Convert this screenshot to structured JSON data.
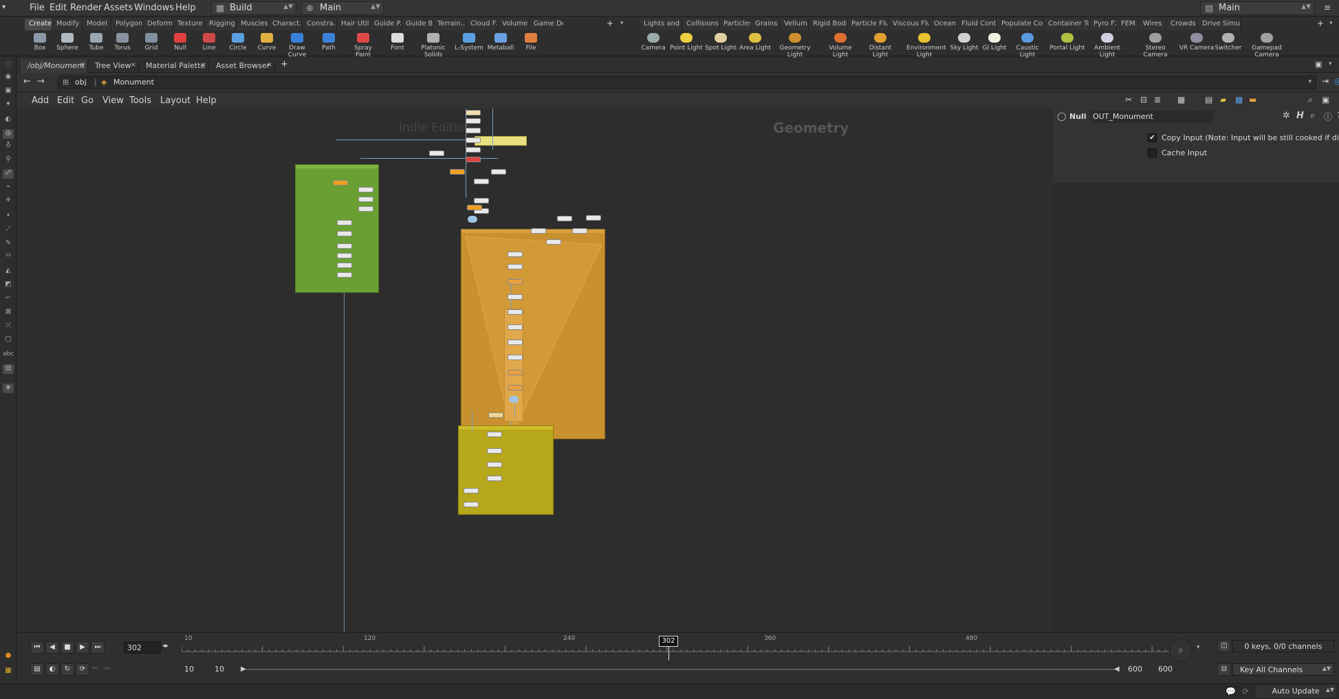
{
  "menubar": {
    "items": [
      "File",
      "Edit",
      "Render",
      "Assets",
      "Windows",
      "Help"
    ],
    "desktop": "Build",
    "context": "Main",
    "right_context": "Main"
  },
  "shelf_left": {
    "tabs": [
      "Create",
      "Modify",
      "Model",
      "Polygon",
      "Deform",
      "Texture",
      "Rigging",
      "Muscles",
      "Charact...",
      "Constra...",
      "Hair Utils",
      "Guide P...",
      "Guide B...",
      "Terrain...",
      "Cloud FX",
      "Volume",
      "Game De..."
    ],
    "tools": [
      {
        "label": "Box",
        "icon": "box-icon"
      },
      {
        "label": "Sphere",
        "icon": "sphere-icon"
      },
      {
        "label": "Tube",
        "icon": "tube-icon"
      },
      {
        "label": "Torus",
        "icon": "torus-icon"
      },
      {
        "label": "Grid",
        "icon": "grid-icon"
      },
      {
        "label": "Null",
        "icon": "null-icon"
      },
      {
        "label": "Line",
        "icon": "line-icon"
      },
      {
        "label": "Circle",
        "icon": "circle-icon"
      },
      {
        "label": "Curve",
        "icon": "curve-icon"
      },
      {
        "label": "Draw Curve",
        "icon": "draw-curve-icon"
      },
      {
        "label": "Path",
        "icon": "path-icon"
      },
      {
        "label": "Spray Paint",
        "icon": "spray-paint-icon"
      },
      {
        "label": "Font",
        "icon": "font-icon"
      },
      {
        "label": "Platonic Solids",
        "icon": "platonic-solids-icon"
      },
      {
        "label": "L-System",
        "icon": "l-system-icon"
      },
      {
        "label": "Metaball",
        "icon": "metaball-icon"
      },
      {
        "label": "File",
        "icon": "file-icon"
      }
    ]
  },
  "shelf_right": {
    "tabs": [
      "Lights and C...",
      "Collisions",
      "Particles",
      "Grains",
      "Vellum",
      "Rigid Bodies",
      "Particle Fluids",
      "Viscous Fluids",
      "Oceans",
      "Fluid Contai...",
      "Populate Con...",
      "Container Tools",
      "Pyro FX",
      "FEM",
      "Wires",
      "Crowds",
      "Drive Simula..."
    ],
    "tools": [
      {
        "label": "Camera",
        "icon": "camera-icon"
      },
      {
        "label": "Point Light",
        "icon": "point-light-icon"
      },
      {
        "label": "Spot Light",
        "icon": "spot-light-icon"
      },
      {
        "label": "Area Light",
        "icon": "area-light-icon"
      },
      {
        "label": "Geometry Light",
        "icon": "geometry-light-icon"
      },
      {
        "label": "Volume Light",
        "icon": "volume-light-icon"
      },
      {
        "label": "Distant Light",
        "icon": "distant-light-icon"
      },
      {
        "label": "Environment Light",
        "icon": "environment-light-icon"
      },
      {
        "label": "Sky Light",
        "icon": "sky-light-icon"
      },
      {
        "label": "GI Light",
        "icon": "gi-light-icon"
      },
      {
        "label": "Caustic Light",
        "icon": "caustic-light-icon"
      },
      {
        "label": "Portal Light",
        "icon": "portal-light-icon"
      },
      {
        "label": "Ambient Light",
        "icon": "ambient-light-icon"
      },
      {
        "label": "Stereo Camera",
        "icon": "stereo-camera-icon"
      },
      {
        "label": "VR Camera",
        "icon": "vr-camera-icon"
      },
      {
        "label": "Switcher",
        "icon": "switcher-icon"
      },
      {
        "label": "Gamepad Camera",
        "icon": "gamepad-camera-icon"
      }
    ]
  },
  "pane_tabs": [
    "/obj/Monument",
    "Tree View",
    "Material Palette",
    "Asset Browser"
  ],
  "path": {
    "root": "obj",
    "current": "Monument"
  },
  "network_menu": [
    "Add",
    "Edit",
    "Go",
    "View",
    "Tools",
    "Layout",
    "Help"
  ],
  "network": {
    "watermark": "Indie Edition",
    "context_label": "Geometry"
  },
  "params": {
    "node_type": "Null",
    "node_name": "OUT_Monument",
    "copy_input_label": "Copy Input (Note: Input will be still cooked if disa...",
    "copy_input_checked": true,
    "cache_input_label": "Cache Input",
    "cache_input_checked": false
  },
  "timeline": {
    "current_frame": "302",
    "ticks": [
      "10",
      "120",
      "240",
      "360",
      "480"
    ],
    "range_start": "10",
    "range_start2": "10",
    "range_end": "600",
    "range_end2": "600",
    "keys_info": "0 keys, 0/0 channels",
    "key_mode": "Key All Channels"
  },
  "status": {
    "update_mode": "Auto Update"
  },
  "colors": {
    "green_box": "#6aa033",
    "orange_box": "#c8902e",
    "yellow_box": "#b7a71a",
    "accent_orange": "#f5a623"
  }
}
